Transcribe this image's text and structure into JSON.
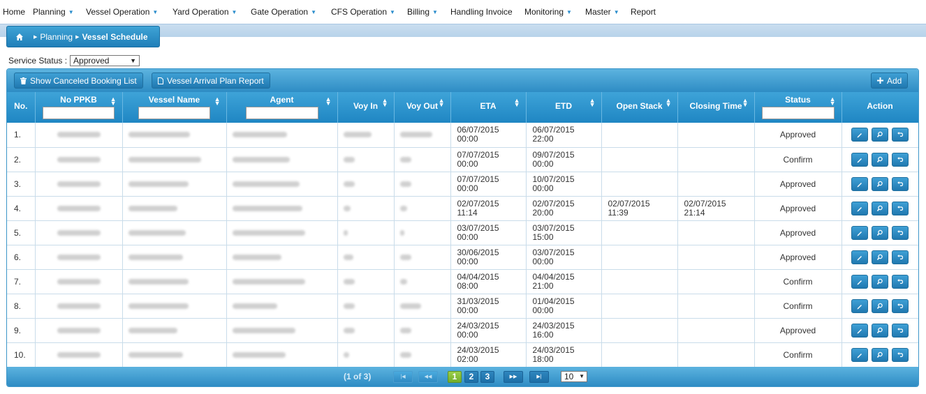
{
  "nav": {
    "items": [
      {
        "label": "Home",
        "caret": false
      },
      {
        "label": "Planning",
        "caret": true
      },
      {
        "label": "Vessel Operation",
        "caret": true
      },
      {
        "label": "Yard Operation",
        "caret": true
      },
      {
        "label": "Gate Operation",
        "caret": true
      },
      {
        "label": "CFS Operation",
        "caret": true
      },
      {
        "label": "Billing",
        "caret": true
      },
      {
        "label": "Handling Invoice",
        "caret": false
      },
      {
        "label": "Monitoring",
        "caret": true
      },
      {
        "label": "Master",
        "caret": true
      },
      {
        "label": "Report",
        "caret": false
      }
    ]
  },
  "breadcrumb": {
    "parent": "Planning",
    "current": "Vessel Schedule"
  },
  "filter": {
    "label": "Service Status :",
    "value": "Approved"
  },
  "toolbar": {
    "show_canceled": "Show Canceled Booking List",
    "arrival_report": "Vessel Arrival Plan Report",
    "add": "Add"
  },
  "columns": {
    "no": "No.",
    "ppkb": "No PPKB",
    "vessel": "Vessel Name",
    "agent": "Agent",
    "voy_in": "Voy In",
    "voy_out": "Voy Out",
    "eta": "ETA",
    "etd": "ETD",
    "open_stack": "Open Stack",
    "closing_time": "Closing Time",
    "status": "Status",
    "action": "Action"
  },
  "rows": [
    {
      "no": "1.",
      "eta_d": "06/07/2015",
      "eta_t": "00:00",
      "etd_d": "06/07/2015",
      "etd_t": "22:00",
      "os_d": "",
      "os_t": "",
      "ct_d": "",
      "ct_t": "",
      "status": "Approved"
    },
    {
      "no": "2.",
      "eta_d": "07/07/2015",
      "eta_t": "00:00",
      "etd_d": "09/07/2015",
      "etd_t": "00:00",
      "os_d": "",
      "os_t": "",
      "ct_d": "",
      "ct_t": "",
      "status": "Confirm"
    },
    {
      "no": "3.",
      "eta_d": "07/07/2015",
      "eta_t": "00:00",
      "etd_d": "10/07/2015",
      "etd_t": "00:00",
      "os_d": "",
      "os_t": "",
      "ct_d": "",
      "ct_t": "",
      "status": "Approved"
    },
    {
      "no": "4.",
      "eta_d": "02/07/2015",
      "eta_t": "11:14",
      "etd_d": "02/07/2015",
      "etd_t": "20:00",
      "os_d": "02/07/2015",
      "os_t": "11:39",
      "ct_d": "02/07/2015",
      "ct_t": "21:14",
      "status": "Approved"
    },
    {
      "no": "5.",
      "eta_d": "03/07/2015",
      "eta_t": "00:00",
      "etd_d": "03/07/2015",
      "etd_t": "15:00",
      "os_d": "",
      "os_t": "",
      "ct_d": "",
      "ct_t": "",
      "status": "Approved"
    },
    {
      "no": "6.",
      "eta_d": "30/06/2015",
      "eta_t": "00:00",
      "etd_d": "03/07/2015",
      "etd_t": "00:00",
      "os_d": "",
      "os_t": "",
      "ct_d": "",
      "ct_t": "",
      "status": "Approved"
    },
    {
      "no": "7.",
      "eta_d": "04/04/2015",
      "eta_t": "08:00",
      "etd_d": "04/04/2015",
      "etd_t": "21:00",
      "os_d": "",
      "os_t": "",
      "ct_d": "",
      "ct_t": "",
      "status": "Confirm"
    },
    {
      "no": "8.",
      "eta_d": "31/03/2015",
      "eta_t": "00:00",
      "etd_d": "01/04/2015",
      "etd_t": "00:00",
      "os_d": "",
      "os_t": "",
      "ct_d": "",
      "ct_t": "",
      "status": "Confirm"
    },
    {
      "no": "9.",
      "eta_d": "24/03/2015",
      "eta_t": "00:00",
      "etd_d": "24/03/2015",
      "etd_t": "16:00",
      "os_d": "",
      "os_t": "",
      "ct_d": "",
      "ct_t": "",
      "status": "Approved"
    },
    {
      "no": "10.",
      "eta_d": "24/03/2015",
      "eta_t": "02:00",
      "etd_d": "24/03/2015",
      "etd_t": "18:00",
      "os_d": "",
      "os_t": "",
      "ct_d": "",
      "ct_t": "",
      "status": "Confirm"
    }
  ],
  "pager": {
    "info": "(1 of 3)",
    "pages": [
      "1",
      "2",
      "3"
    ],
    "current_page": "1",
    "page_size": "10"
  },
  "colors": {
    "accent": "#2a8dcc",
    "header": "#1f86c3",
    "active_page": "#72ad2b"
  }
}
